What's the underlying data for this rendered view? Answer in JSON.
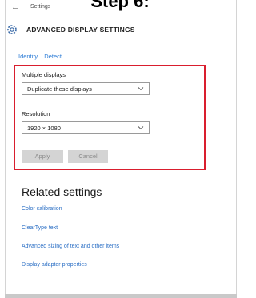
{
  "caption": "Step 6:",
  "window": {
    "title": "Settings",
    "page_title": "ADVANCED DISPLAY SETTINGS"
  },
  "links": {
    "identify": "Identify",
    "detect": "Detect"
  },
  "multiple_displays": {
    "label": "Multiple displays",
    "value": "Duplicate these displays"
  },
  "resolution": {
    "label": "Resolution",
    "value": "1920 × 1080"
  },
  "buttons": {
    "apply": "Apply",
    "cancel": "Cancel"
  },
  "related": {
    "title": "Related settings",
    "items": [
      "Color calibration",
      "ClearType text",
      "Advanced sizing of text and other items",
      "Display adapter properties"
    ]
  },
  "colors": {
    "accent_link": "#2b6fc5",
    "highlight_border": "#d91e2e",
    "button_bg": "#d4d4d4"
  },
  "icons": [
    "back-arrow-icon",
    "gear-icon",
    "chevron-down-icon"
  ]
}
